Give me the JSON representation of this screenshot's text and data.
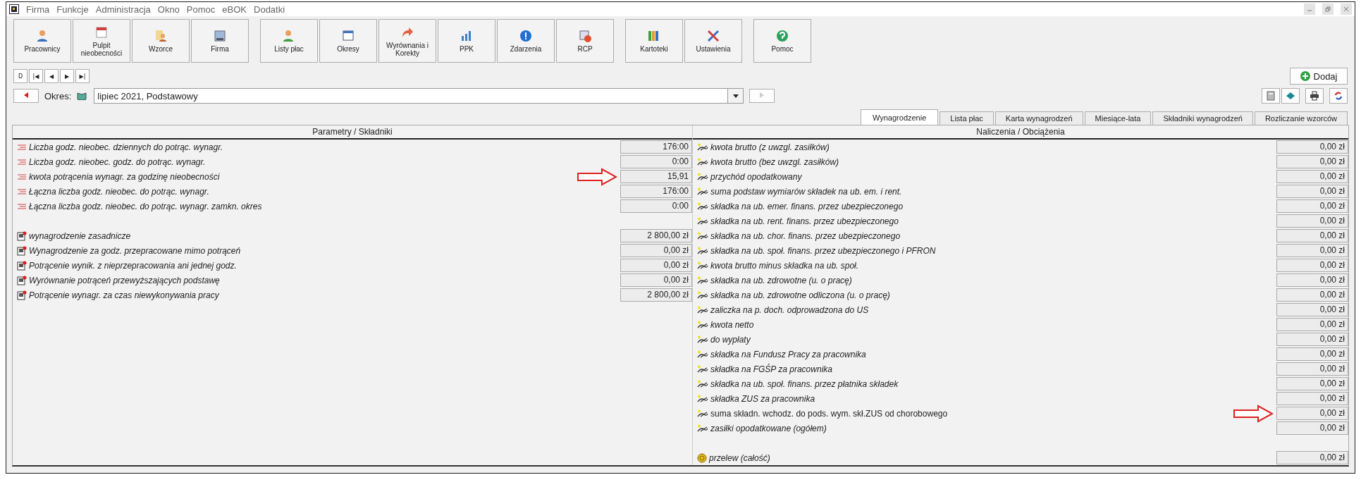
{
  "menu": [
    "Firma",
    "Funkcje",
    "Administracja",
    "Okno",
    "Pomoc",
    "eBOK",
    "Dodatki"
  ],
  "toolbar_groups": [
    [
      {
        "label": "Pracownicy"
      },
      {
        "label": "Pulpit nieobecności"
      },
      {
        "label": "Wzorce"
      },
      {
        "label": "Firma"
      }
    ],
    [
      {
        "label": "Listy płac"
      },
      {
        "label": "Okresy"
      },
      {
        "label": "Wyrównania i Korekty"
      },
      {
        "label": "PPK"
      },
      {
        "label": "Zdarzenia"
      },
      {
        "label": "RCP"
      }
    ],
    [
      {
        "label": "Kartoteki"
      },
      {
        "label": "Ustawienia"
      }
    ],
    [
      {
        "label": "Pomoc"
      }
    ]
  ],
  "nav_buttons": [
    "D",
    "|◀",
    "◀",
    "▶",
    "▶|"
  ],
  "add_button": "Dodaj",
  "period": {
    "label": "Okres:",
    "value": "lipiec 2021, Podstawowy"
  },
  "tabs": [
    {
      "label": "Wynagrodzenie",
      "selected": true
    },
    {
      "label": "Lista płac",
      "selected": false
    },
    {
      "label": "Karta wynagrodzeń",
      "selected": false
    },
    {
      "label": "Miesiące-lata",
      "selected": false
    },
    {
      "label": "Składniki wynagrodzeń",
      "selected": false
    },
    {
      "label": "Rozliczanie wzorców",
      "selected": false
    }
  ],
  "left": {
    "header": "Parametry / Składniki",
    "parameters": [
      {
        "label": "Liczba godz. nieobec. dziennych do potrąc. wynagr.",
        "value": "176:00",
        "arrow": false
      },
      {
        "label": "Liczba godz. nieobec. godz. do potrąc. wynagr.",
        "value": "0:00",
        "arrow": false
      },
      {
        "label": "kwota potrącenia wynagr. za godzinę nieobecności",
        "value": "15,91",
        "arrow": true
      },
      {
        "label": "Łączna liczba godz. nieobec. do potrąc. wynagr.",
        "value": "176:00",
        "arrow": false
      },
      {
        "label": "Łączna liczba godz. nieobec. do potrąc. wynagr. zamkn. okres",
        "value": "0:00",
        "arrow": false
      }
    ],
    "components": [
      {
        "label": "wynagrodzenie zasadnicze",
        "value": "2 800,00 zł"
      },
      {
        "label": "Wynagrodzenie za godz. przepracowane mimo potrąceń",
        "value": "0,00 zł"
      },
      {
        "label": "Potrącenie wynik. z nieprzepracowania ani jednej godz.",
        "value": "0,00 zł"
      },
      {
        "label": "Wyrównanie potrąceń przewyższających podstawę",
        "value": "0,00 zł"
      },
      {
        "label": "Potrącenie wynagr. za czas niewykonywania pracy",
        "value": "2 800,00 zł"
      }
    ]
  },
  "right": {
    "header": "Naliczenia / Obciążenia",
    "charges": [
      {
        "label": "kwota brutto (z uwzgl. zasiłków)",
        "value": "0,00 zł",
        "italic": true,
        "arrow": false
      },
      {
        "label": "kwota brutto (bez uwzgl. zasiłków)",
        "value": "0,00 zł",
        "italic": true,
        "arrow": false
      },
      {
        "label": "przychód opodatkowany",
        "value": "0,00 zł",
        "italic": true,
        "arrow": false
      },
      {
        "label": "suma podstaw wymiarów składek na ub. em. i rent.",
        "value": "0,00 zł",
        "italic": true,
        "arrow": false
      },
      {
        "label": "składka na ub. emer. finans. przez ubezpieczonego",
        "value": "0,00 zł",
        "italic": true,
        "arrow": false
      },
      {
        "label": "składka na ub. rent. finans. przez ubezpieczonego",
        "value": "0,00 zł",
        "italic": true,
        "arrow": false
      },
      {
        "label": "składka na ub. chor. finans. przez ubezpieczonego",
        "value": "0,00 zł",
        "italic": true,
        "arrow": false
      },
      {
        "label": "składka na ub. społ. finans. przez ubezpieczonego i PFRON",
        "value": "0,00 zł",
        "italic": true,
        "arrow": false
      },
      {
        "label": "kwota brutto minus składka na ub. społ.",
        "value": "0,00 zł",
        "italic": true,
        "arrow": false
      },
      {
        "label": "składka na ub. zdrowotne (u. o pracę)",
        "value": "0,00 zł",
        "italic": true,
        "arrow": false
      },
      {
        "label": "składka na ub. zdrowotne odliczona (u. o pracę)",
        "value": "0,00 zł",
        "italic": true,
        "arrow": false
      },
      {
        "label": "zaliczka na p. doch. odprowadzona do US",
        "value": "0,00 zł",
        "italic": true,
        "arrow": false
      },
      {
        "label": "kwota netto",
        "value": "0,00 zł",
        "italic": true,
        "arrow": false
      },
      {
        "label": "do wypłaty",
        "value": "0,00 zł",
        "italic": true,
        "arrow": false
      },
      {
        "label": "składka na Fundusz Pracy za pracownika",
        "value": "0,00 zł",
        "italic": true,
        "arrow": false
      },
      {
        "label": "składka na FGŚP za pracownika",
        "value": "0,00 zł",
        "italic": true,
        "arrow": false
      },
      {
        "label": "składka na ub. społ. finans. przez płatnika składek",
        "value": "0,00 zł",
        "italic": true,
        "arrow": false
      },
      {
        "label": "składka ZUS za pracownika",
        "value": "0,00 zł",
        "italic": true,
        "arrow": false
      },
      {
        "label": "suma składn. wchodz. do pods. wym. skł.ZUS od chorobowego",
        "value": "0,00 zł",
        "italic": false,
        "arrow": true
      },
      {
        "label": "zasiłki opodatkowane (ogółem)",
        "value": "0,00 zł",
        "italic": true,
        "arrow": false
      }
    ],
    "total": {
      "label": "przelew (całość)",
      "value": "0,00 zł"
    }
  }
}
